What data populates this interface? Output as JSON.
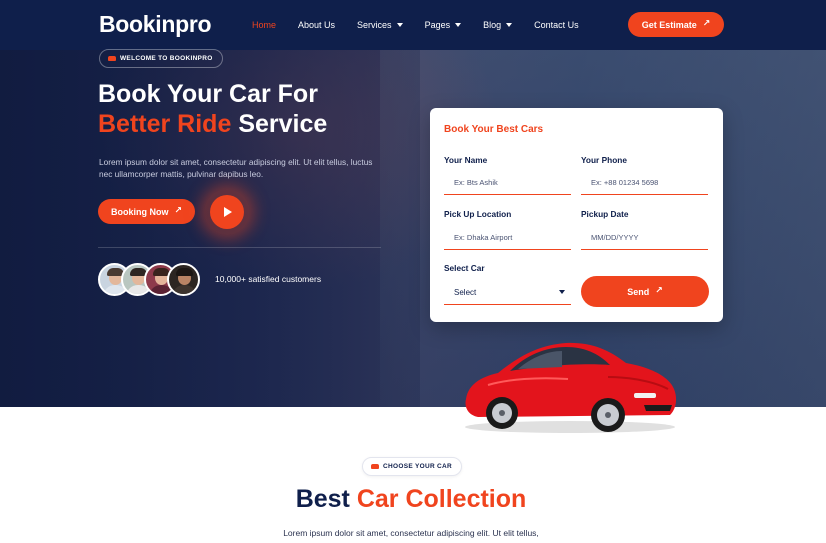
{
  "brand": {
    "logo": "Bookinpro"
  },
  "colors": {
    "accent": "#f0441e",
    "navy": "#0f1f4b"
  },
  "nav": {
    "items": [
      {
        "label": "Home",
        "active": true,
        "dropdown": false
      },
      {
        "label": "About Us",
        "active": false,
        "dropdown": false
      },
      {
        "label": "Services",
        "active": false,
        "dropdown": true
      },
      {
        "label": "Pages",
        "active": false,
        "dropdown": true
      },
      {
        "label": "Blog",
        "active": false,
        "dropdown": true
      },
      {
        "label": "Contact Us",
        "active": false,
        "dropdown": false
      }
    ],
    "cta": "Get Estimate",
    "cta_icon": "arrow-up-right-icon"
  },
  "hero": {
    "badge": "WELCOME TO BOOKINPRO",
    "title_line1": "Book Your Car For",
    "title_accent": "Better Ride",
    "title_rest": " Service",
    "description": "Lorem ipsum dolor sit amet, consectetur adipiscing elit. Ut elit tellus, luctus nec ullamcorper mattis, pulvinar dapibus leo.",
    "booking_button": "Booking Now",
    "customers": "10,000+ satisfied customers"
  },
  "form": {
    "title": "Book Your Best Cars",
    "name_label": "Your Name",
    "name_placeholder": "Ex: Bts Ashik",
    "phone_label": "Your Phone",
    "phone_placeholder": "Ex: +88 01234 5698",
    "pickup_label": "Pick Up Location",
    "pickup_placeholder": "Ex: Dhaka Airport",
    "date_label": "Pickup Date",
    "date_placeholder": "MM/DD/YYYY",
    "car_label": "Select Car",
    "car_selected": "Select",
    "send_button": "Send"
  },
  "collection": {
    "badge": "CHOOSE YOUR CAR",
    "title_plain": "Best ",
    "title_accent": "Car Collection",
    "description": "Lorem ipsum dolor sit amet, consectetur adipiscing elit. Ut elit tellus,"
  }
}
